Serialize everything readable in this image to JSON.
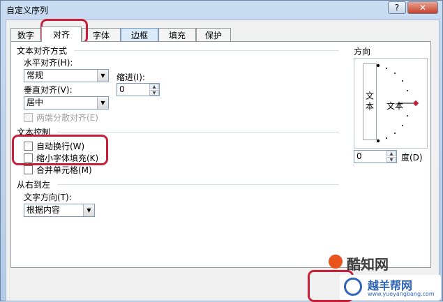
{
  "window": {
    "title": "自定义序列",
    "help_label": "?",
    "close_label": "✕"
  },
  "tabs": [
    {
      "label": "数字",
      "active": false
    },
    {
      "label": "对齐",
      "active": true
    },
    {
      "label": "字体",
      "active": false
    },
    {
      "label": "边框",
      "active": false
    },
    {
      "label": "填充",
      "active": false
    },
    {
      "label": "保护",
      "active": false
    }
  ],
  "text_alignment": {
    "section_title": "文本对齐方式",
    "horizontal_label": "水平对齐(H):",
    "horizontal_value": "常规",
    "indent_label": "缩进(I):",
    "indent_value": "0",
    "vertical_label": "垂直对齐(V):",
    "vertical_value": "居中",
    "justify_distributed_label": "两端分散对齐(E)"
  },
  "text_control": {
    "section_title": "文本控制",
    "wrap_text_label": "自动换行(W)",
    "shrink_to_fit_label": "缩小字体填充(K)",
    "merge_cells_label": "合并单元格(M)"
  },
  "right_to_left": {
    "section_title": "从右到左",
    "direction_label": "文字方向(T):",
    "direction_value": "根据内容"
  },
  "orientation": {
    "section_title": "方向",
    "vertical_text": "文本",
    "text_label": "文本",
    "degrees_value": "0",
    "degrees_label": "度(D)"
  },
  "watermarks": {
    "site_name": "酷知网",
    "brand_name": "越羊帮网",
    "url": "www.yueyangbang.com"
  },
  "colors": {
    "highlight": "#c8203a",
    "accent": "#e8541c",
    "brand_blue": "#2f64b6"
  },
  "icons": {
    "arrow": "chevron-down-icon",
    "spin": "spin-arrows-icon"
  }
}
